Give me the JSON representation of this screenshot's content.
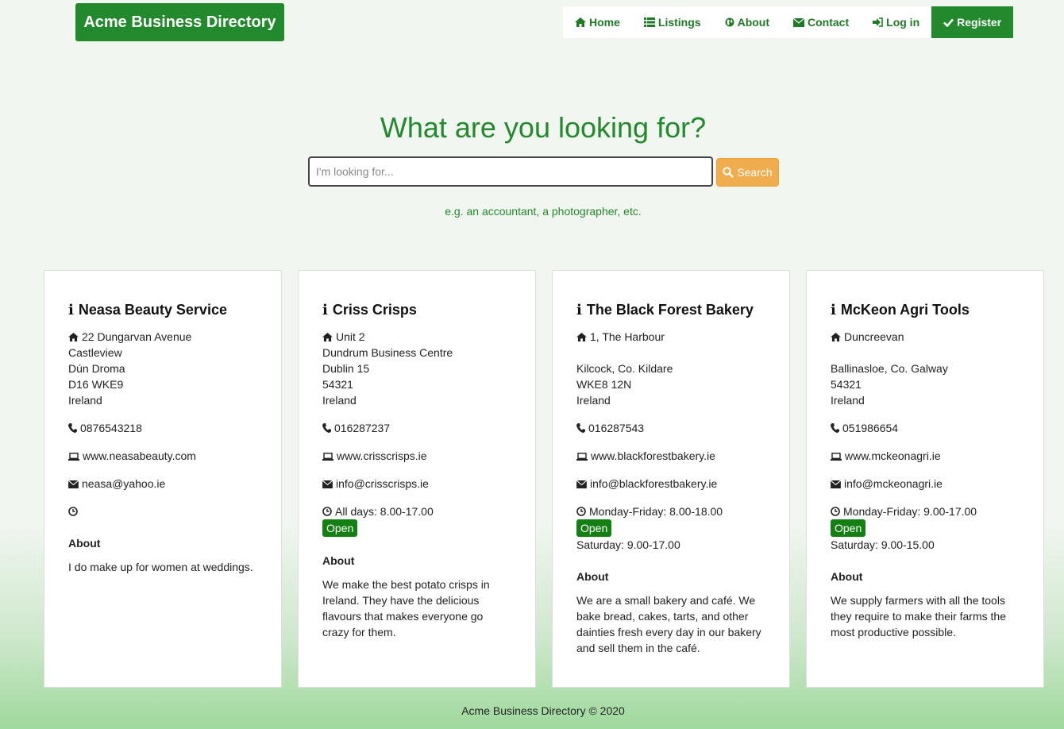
{
  "brand": "Acme Business Directory",
  "nav": {
    "home": "Home",
    "listings": "Listings",
    "about": "About",
    "contact": "Contact",
    "login": "Log in",
    "register": "Register"
  },
  "hero": {
    "title": "What are you looking for?",
    "placeholder": "I'm looking for...",
    "search_label": "Search",
    "hint": "e.g. an accountant, a photographer, etc."
  },
  "labels": {
    "about": "About"
  },
  "cards": [
    {
      "name": "Neasa Beauty Service",
      "address": [
        "22 Dungarvan Avenue",
        "Castleview",
        "Dún Droma",
        "D16 WKE9",
        "Ireland"
      ],
      "phone": "0876543218",
      "website": "www.neasabeauty.com",
      "email": "neasa@yahoo.ie",
      "hours": [
        ""
      ],
      "about": "I do make up for women at weddings."
    },
    {
      "name": "Criss Crisps",
      "address": [
        "Unit 2",
        "Dundrum Business Centre",
        "Dublin 15",
        "54321",
        "Ireland"
      ],
      "phone": "016287237",
      "website": "www.crisscrisps.ie",
      "email": "info@crisscrisps.ie",
      "hours": [
        "All days: 8.00-17.00"
      ],
      "status": "Open",
      "about": "We make the best potato crisps in Ireland. They have the delicious flavours that makes everyone go crazy for them."
    },
    {
      "name": "The Black Forest Bakery",
      "address": [
        "1, The Harbour",
        "",
        "Kilcock, Co. Kildare",
        "WKE8 12N",
        "Ireland"
      ],
      "phone": "016287543",
      "website": "www.blackforestbakery.ie",
      "email": "info@blackforestbakery.ie",
      "hours": [
        "Monday-Friday: 8.00-18.00",
        "Saturday: 9.00-17.00"
      ],
      "status": "Open",
      "about": "We are a small bakery and café. We bake bread, cakes, tarts, and other dainties fresh every day in our bakery and sell them in the café."
    },
    {
      "name": "McKeon Agri Tools",
      "address": [
        "Duncreevan",
        "",
        "Ballinasloe, Co. Galway",
        "54321",
        "Ireland"
      ],
      "phone": "051986654",
      "website": "www.mckeonagri.ie",
      "email": "info@mckeonagri.ie",
      "hours": [
        "Monday-Friday: 9.00-17.00",
        "Saturday: 9.00-15.00"
      ],
      "status": "Open",
      "about": "We supply farmers with all the tools they require to make their farms the most productive possible."
    }
  ],
  "footer": "Acme Business Directory © 2020",
  "colors": {
    "brand_green": "#22892c",
    "open_green": "#148014",
    "search_orange": "#f0ad4e"
  }
}
